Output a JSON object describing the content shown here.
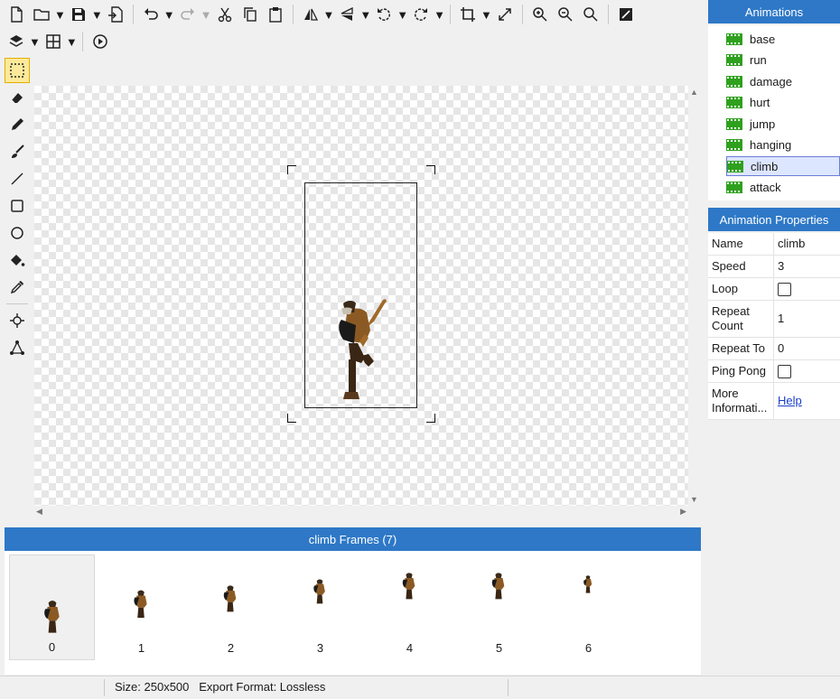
{
  "animations_panel": {
    "title": "Animations",
    "items": [
      {
        "label": "base"
      },
      {
        "label": "run"
      },
      {
        "label": "damage"
      },
      {
        "label": "hurt"
      },
      {
        "label": "jump"
      },
      {
        "label": "hanging"
      },
      {
        "label": "climb",
        "selected": true
      },
      {
        "label": "attack"
      }
    ]
  },
  "properties_panel": {
    "title": "Animation Properties",
    "rows": {
      "name": {
        "label": "Name",
        "value": "climb"
      },
      "speed": {
        "label": "Speed",
        "value": "3"
      },
      "loop": {
        "label": "Loop",
        "checked": false
      },
      "repeat_count": {
        "label": "Repeat Count",
        "value": "1"
      },
      "repeat_to": {
        "label": "Repeat To",
        "value": "0"
      },
      "ping_pong": {
        "label": "Ping Pong",
        "checked": false
      },
      "more_info": {
        "label": "More Informati...",
        "value": "Help"
      }
    }
  },
  "frames_panel": {
    "title": "climb Frames (7)",
    "frames": [
      "0",
      "1",
      "2",
      "3",
      "4",
      "5",
      "6"
    ],
    "selected_index": 0
  },
  "status_bar": {
    "text": "Size: 250x500   Export Format: Lossless"
  },
  "colors": {
    "accent": "#2e78c7",
    "selection_bg": "#dde6ff",
    "active_tool": "#fde99a",
    "film_icon": "#2fa01e"
  },
  "toolbar": {
    "icons": [
      "new-file-icon",
      "open-folder-icon",
      "save-icon",
      "export-icon",
      "undo-icon",
      "redo-icon",
      "cut-icon",
      "copy-icon",
      "paste-icon",
      "flip-horizontal-icon",
      "flip-vertical-icon",
      "rotate-left-icon",
      "rotate-right-icon",
      "crop-icon",
      "resize-icon",
      "zoom-in-icon",
      "zoom-out-icon",
      "zoom-fit-icon",
      "invert-color-icon",
      "layers-icon",
      "grid-icon",
      "play-icon"
    ]
  },
  "tools": {
    "icons": [
      "selection-icon",
      "eraser-icon",
      "pencil-icon",
      "brush-icon",
      "line-icon",
      "rectangle-icon",
      "ellipse-icon",
      "fill-bucket-icon",
      "eyedropper-icon",
      "origin-point-icon",
      "nodes-icon"
    ]
  }
}
